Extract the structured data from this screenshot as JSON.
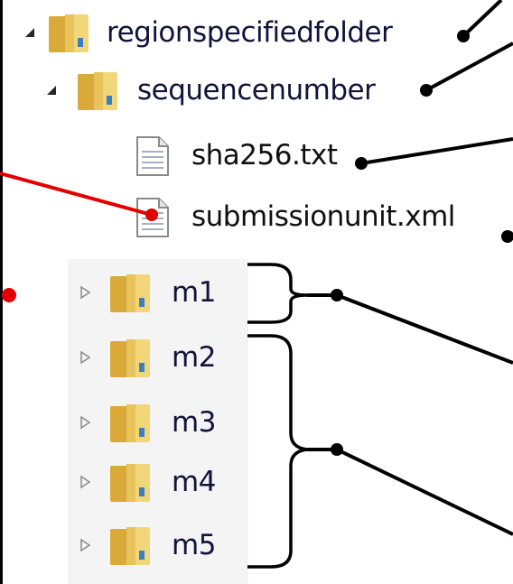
{
  "tree": {
    "root": {
      "label": "regionspecifiedfolder",
      "icon": "folder-icon",
      "expanded": true,
      "children": [
        {
          "label": "sequencenumber",
          "icon": "folder-icon",
          "expanded": true,
          "children": [
            {
              "label": "sha256.txt",
              "icon": "text-file-icon"
            },
            {
              "label": "submissionunit.xml",
              "icon": "text-file-icon"
            }
          ]
        },
        {
          "label": "m1",
          "icon": "folder-icon",
          "expanded": false
        },
        {
          "label": "m2",
          "icon": "folder-icon",
          "expanded": false
        },
        {
          "label": "m3",
          "icon": "folder-icon",
          "expanded": false
        },
        {
          "label": "m4",
          "icon": "folder-icon",
          "expanded": false
        },
        {
          "label": "m5",
          "icon": "folder-icon",
          "expanded": false
        }
      ]
    }
  },
  "colors": {
    "leader_line_black": "#000000",
    "leader_line_red": "#e00000",
    "folder_gold": "#e8c25a",
    "folder_blue_tab": "#3b7fc2"
  }
}
